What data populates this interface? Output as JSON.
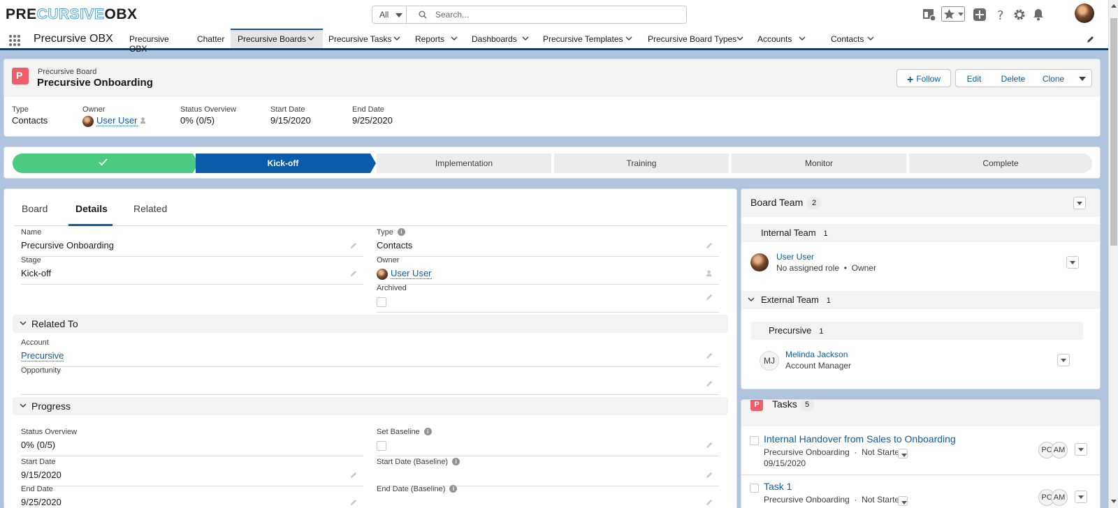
{
  "brand": {
    "logo_left": "PRE",
    "logo_mid": "CURSIVE",
    "logo_right": "OBX"
  },
  "search": {
    "scope": "All",
    "placeholder": "Search..."
  },
  "nav": {
    "app_name": "Precursive OBX",
    "items": [
      {
        "label": "Precursive OBX",
        "has_menu": false
      },
      {
        "label": "Chatter",
        "has_menu": false
      },
      {
        "label": "Precursive Boards",
        "has_menu": true,
        "active": true
      },
      {
        "label": "Precursive Tasks",
        "has_menu": true
      },
      {
        "label": "Reports",
        "has_menu": true
      },
      {
        "label": "Dashboards",
        "has_menu": true
      },
      {
        "label": "Precursive Templates",
        "has_menu": true
      },
      {
        "label": "Precursive Board Types",
        "has_menu": true
      },
      {
        "label": "Accounts",
        "has_menu": true
      },
      {
        "label": "Contacts",
        "has_menu": true
      }
    ]
  },
  "record": {
    "object_type": "Precursive Board",
    "title": "Precursive Onboarding",
    "icon_letter": "P",
    "actions": {
      "follow": "Follow",
      "edit": "Edit",
      "delete": "Delete",
      "clone": "Clone"
    },
    "highlights": [
      {
        "label": "Type",
        "value": "Contacts"
      },
      {
        "label": "Owner",
        "value": "User User"
      },
      {
        "label": "Status Overview",
        "value": "0% (0/5)"
      },
      {
        "label": "Start Date",
        "value": "9/15/2020"
      },
      {
        "label": "End Date",
        "value": "9/25/2020"
      }
    ]
  },
  "path": {
    "stages": [
      {
        "label": "",
        "status": "complete"
      },
      {
        "label": "Kick-off",
        "status": "current"
      },
      {
        "label": "Implementation",
        "status": "incomplete"
      },
      {
        "label": "Training",
        "status": "incomplete"
      },
      {
        "label": "Monitor",
        "status": "incomplete"
      },
      {
        "label": "Complete",
        "status": "incomplete"
      }
    ]
  },
  "details": {
    "tabs": [
      "Board",
      "Details",
      "Related"
    ],
    "active_tab": "Details",
    "fields": {
      "name": {
        "label": "Name",
        "value": "Precursive Onboarding"
      },
      "type": {
        "label": "Type",
        "value": "Contacts"
      },
      "stage": {
        "label": "Stage",
        "value": "Kick-off"
      },
      "owner": {
        "label": "Owner",
        "value": "User User"
      },
      "archived": {
        "label": "Archived",
        "checked": false
      }
    },
    "sections": {
      "related_to": {
        "title": "Related To",
        "account": {
          "label": "Account",
          "value": "Precursive"
        },
        "opportunity": {
          "label": "Opportunity",
          "value": ""
        }
      },
      "progress": {
        "title": "Progress",
        "status_overview": {
          "label": "Status Overview",
          "value": "0% (0/5)"
        },
        "set_baseline": {
          "label": "Set Baseline",
          "checked": false
        },
        "start_date": {
          "label": "Start Date",
          "value": "9/15/2020"
        },
        "start_date_baseline": {
          "label": "Start Date (Baseline)",
          "value": ""
        },
        "end_date": {
          "label": "End Date",
          "value": "9/25/2020"
        },
        "end_date_baseline": {
          "label": "End Date (Baseline)",
          "value": ""
        }
      }
    }
  },
  "board_team": {
    "title": "Board Team",
    "count": "2",
    "internal": {
      "title": "Internal Team",
      "count": "1",
      "member": {
        "name": "User User",
        "role": "No assigned role",
        "tag": "Owner"
      }
    },
    "external": {
      "title": "External Team",
      "count": "1",
      "org": {
        "name": "Precursive",
        "count": "1"
      },
      "member": {
        "initials": "MJ",
        "name": "Melinda Jackson",
        "role": "Account Manager"
      }
    }
  },
  "tasks": {
    "title": "Tasks",
    "count": "5",
    "items": [
      {
        "title": "Internal Handover from Sales to Onboarding",
        "board": "Precursive Onboarding",
        "status": "Not Started",
        "date": "09/15/2020",
        "assignees": [
          "PC",
          "AM"
        ]
      },
      {
        "title": "Task 1",
        "board": "Precursive Onboarding",
        "status": "Not Started",
        "date": "",
        "assignees": [
          "PC",
          "AM"
        ]
      }
    ]
  },
  "colors": {
    "brand_blue": "#0b5cab",
    "path_complete": "#4bca81",
    "record_icon": "#f05c6a",
    "nav_border": "#014486"
  }
}
